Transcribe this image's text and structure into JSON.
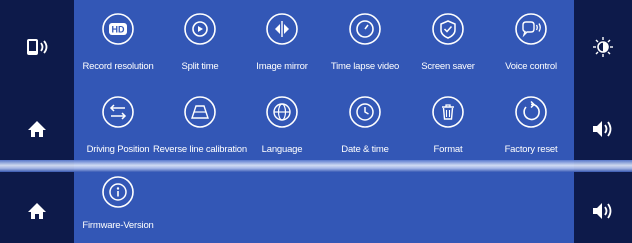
{
  "menu": {
    "items": [
      {
        "label": "Record resolution",
        "icon": "hd-icon"
      },
      {
        "label": "Split time",
        "icon": "split-time-icon"
      },
      {
        "label": "Image mirror",
        "icon": "image-mirror-icon"
      },
      {
        "label": "Time lapse video",
        "icon": "time-lapse-icon"
      },
      {
        "label": "Screen saver",
        "icon": "screen-saver-icon"
      },
      {
        "label": "Voice control",
        "icon": "voice-control-icon"
      },
      {
        "label": "Driving Position",
        "icon": "driving-position-icon"
      },
      {
        "label": "Reverse line calibration",
        "icon": "reverse-line-icon"
      },
      {
        "label": "Language",
        "icon": "language-icon"
      },
      {
        "label": "Date & time",
        "icon": "date-time-icon"
      },
      {
        "label": "Format",
        "icon": "format-icon"
      },
      {
        "label": "Factory reset",
        "icon": "factory-reset-icon"
      },
      {
        "label": "Firmware-Version",
        "icon": "firmware-info-icon"
      }
    ]
  },
  "left_bar": {
    "buttons": [
      "phone-link-icon",
      "home-icon",
      "home-icon"
    ]
  },
  "right_bar": {
    "buttons": [
      "brightness-icon",
      "volume-icon",
      "volume-icon"
    ]
  },
  "colors": {
    "panel": "#3357b6",
    "side_bar": "#0d1a4a",
    "icon_ring": "#ffffff"
  }
}
